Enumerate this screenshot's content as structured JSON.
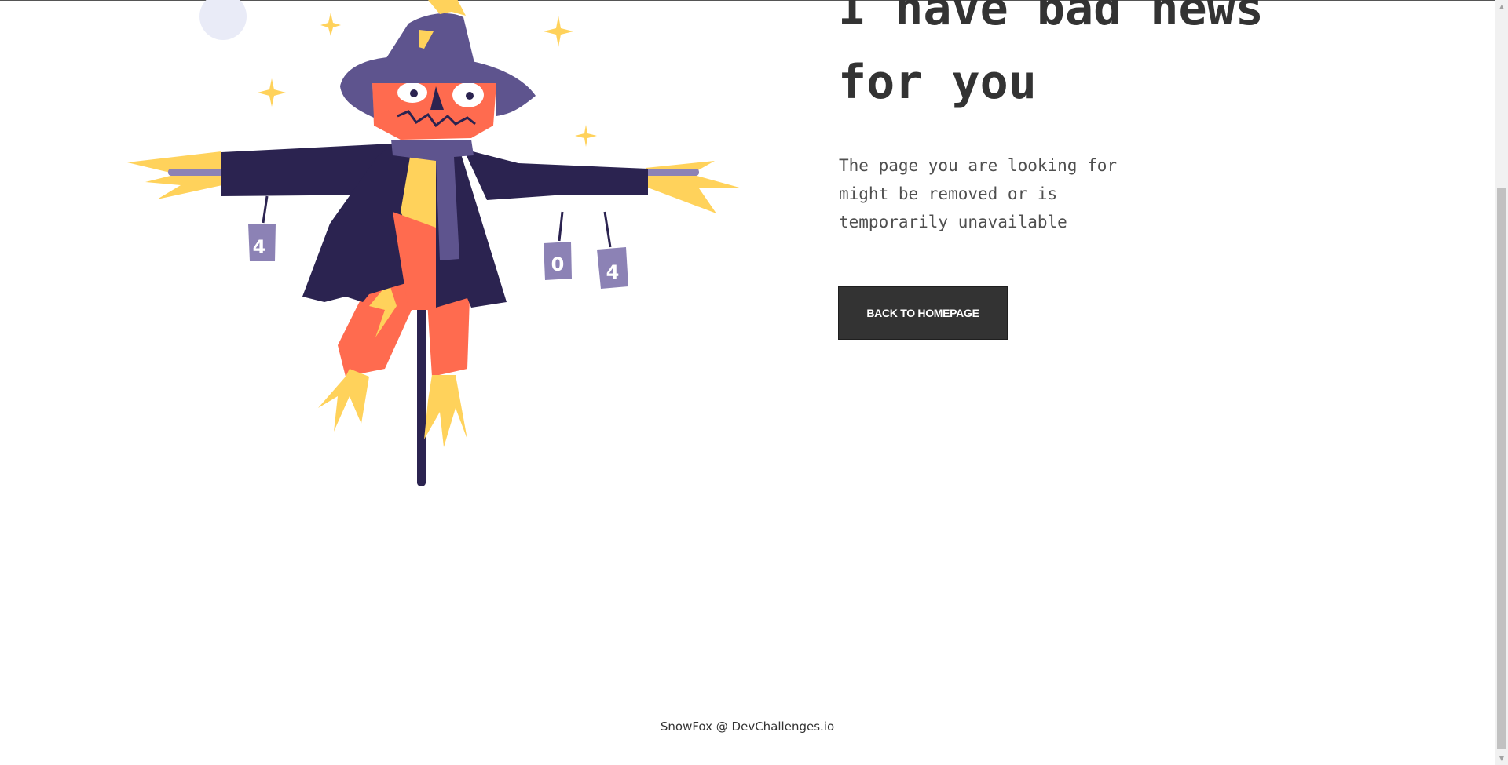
{
  "main": {
    "headline": "I have bad news for you",
    "description": "The page you are looking for might be removed or is temporarily unavailable",
    "button_label": "BACK TO HOMEPAGE"
  },
  "illustration": {
    "can_left": "4",
    "can_middle": "0",
    "can_right": "4"
  },
  "footer": {
    "credit": "SnowFox @ DevChallenges.io"
  },
  "colors": {
    "text_dark": "#333333",
    "coat": "#2B2350",
    "hat": "#5E548E",
    "face": "#FF6B4F",
    "straw": "#FFD25B",
    "can": "#8C82B5",
    "moon": "#E9EBF7"
  },
  "icons": {
    "scroll_up": "triangle-up-icon",
    "scroll_down": "triangle-down-icon"
  }
}
